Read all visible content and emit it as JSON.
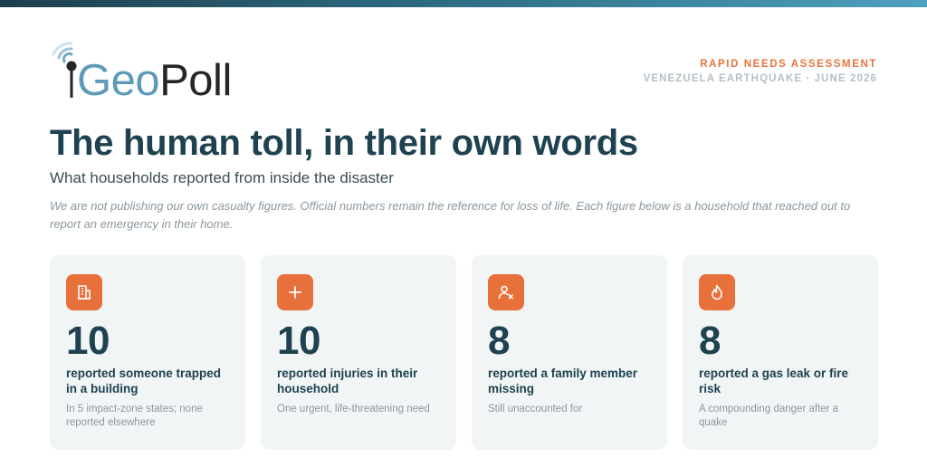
{
  "brand": {
    "logo_geo": "Geo",
    "logo_poll": "Poll"
  },
  "header": {
    "kicker": "RAPID NEEDS ASSESSMENT",
    "event": "VENEZUELA EARTHQUAKE · JUNE 2026"
  },
  "main": {
    "title": "The human toll, in their own words",
    "subtitle": "What households reported from inside the disaster",
    "note": "We are not publishing our own casualty figures. Official numbers remain the reference for loss of life. Each figure below is a household that reached out to report an emergency in their home."
  },
  "colors": {
    "accent": "#e8703a",
    "heading": "#1e4250",
    "card_bg": "#f1f5f6"
  },
  "cards": [
    {
      "icon": "building-icon",
      "value": "10",
      "label": "reported someone trapped in a building",
      "desc": "In 5 impact-zone states; none reported elsewhere"
    },
    {
      "icon": "plus-icon",
      "value": "10",
      "label": "reported injuries in their household",
      "desc": "One urgent, life-threatening need"
    },
    {
      "icon": "person-x-icon",
      "value": "8",
      "label": "reported a family member missing",
      "desc": "Still unaccounted for"
    },
    {
      "icon": "flame-icon",
      "value": "8",
      "label": "reported a gas leak or fire risk",
      "desc": "A compounding danger after a quake"
    }
  ]
}
